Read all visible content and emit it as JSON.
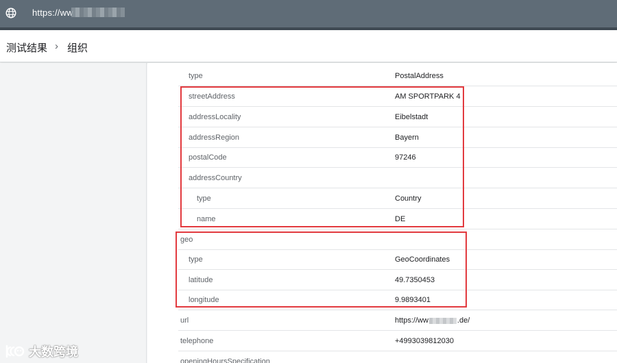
{
  "address_bar": {
    "url_prefix": "https://ww"
  },
  "breadcrumb": {
    "parent": "测试结果",
    "separator": "›",
    "current": "组织"
  },
  "rows": [
    {
      "key": "type",
      "value": "PostalAddress"
    },
    {
      "key": "streetAddress",
      "value": "AM SPORTPARK 4"
    },
    {
      "key": "addressLocality",
      "value": "Eibelstadt"
    },
    {
      "key": "addressRegion",
      "value": "Bayern"
    },
    {
      "key": "postalCode",
      "value": "97246"
    },
    {
      "key": "addressCountry",
      "value": ""
    },
    {
      "key": "type",
      "value": "Country"
    },
    {
      "key": "name",
      "value": "DE"
    },
    {
      "key": "geo",
      "value": ""
    },
    {
      "key": "type",
      "value": "GeoCoordinates"
    },
    {
      "key": "latitude",
      "value": "49.7350453"
    },
    {
      "key": "longitude",
      "value": "9.9893401"
    },
    {
      "key": "url",
      "value_prefix": "https://ww",
      "value_suffix": ".de/"
    },
    {
      "key": "telephone",
      "value": "+4993039812030"
    },
    {
      "key": "openingHoursSpecification",
      "value": ""
    }
  ],
  "watermark": {
    "text": "大数跨境"
  },
  "colors": {
    "highlight": "#e2393e",
    "topbar": "#5f6c77"
  }
}
